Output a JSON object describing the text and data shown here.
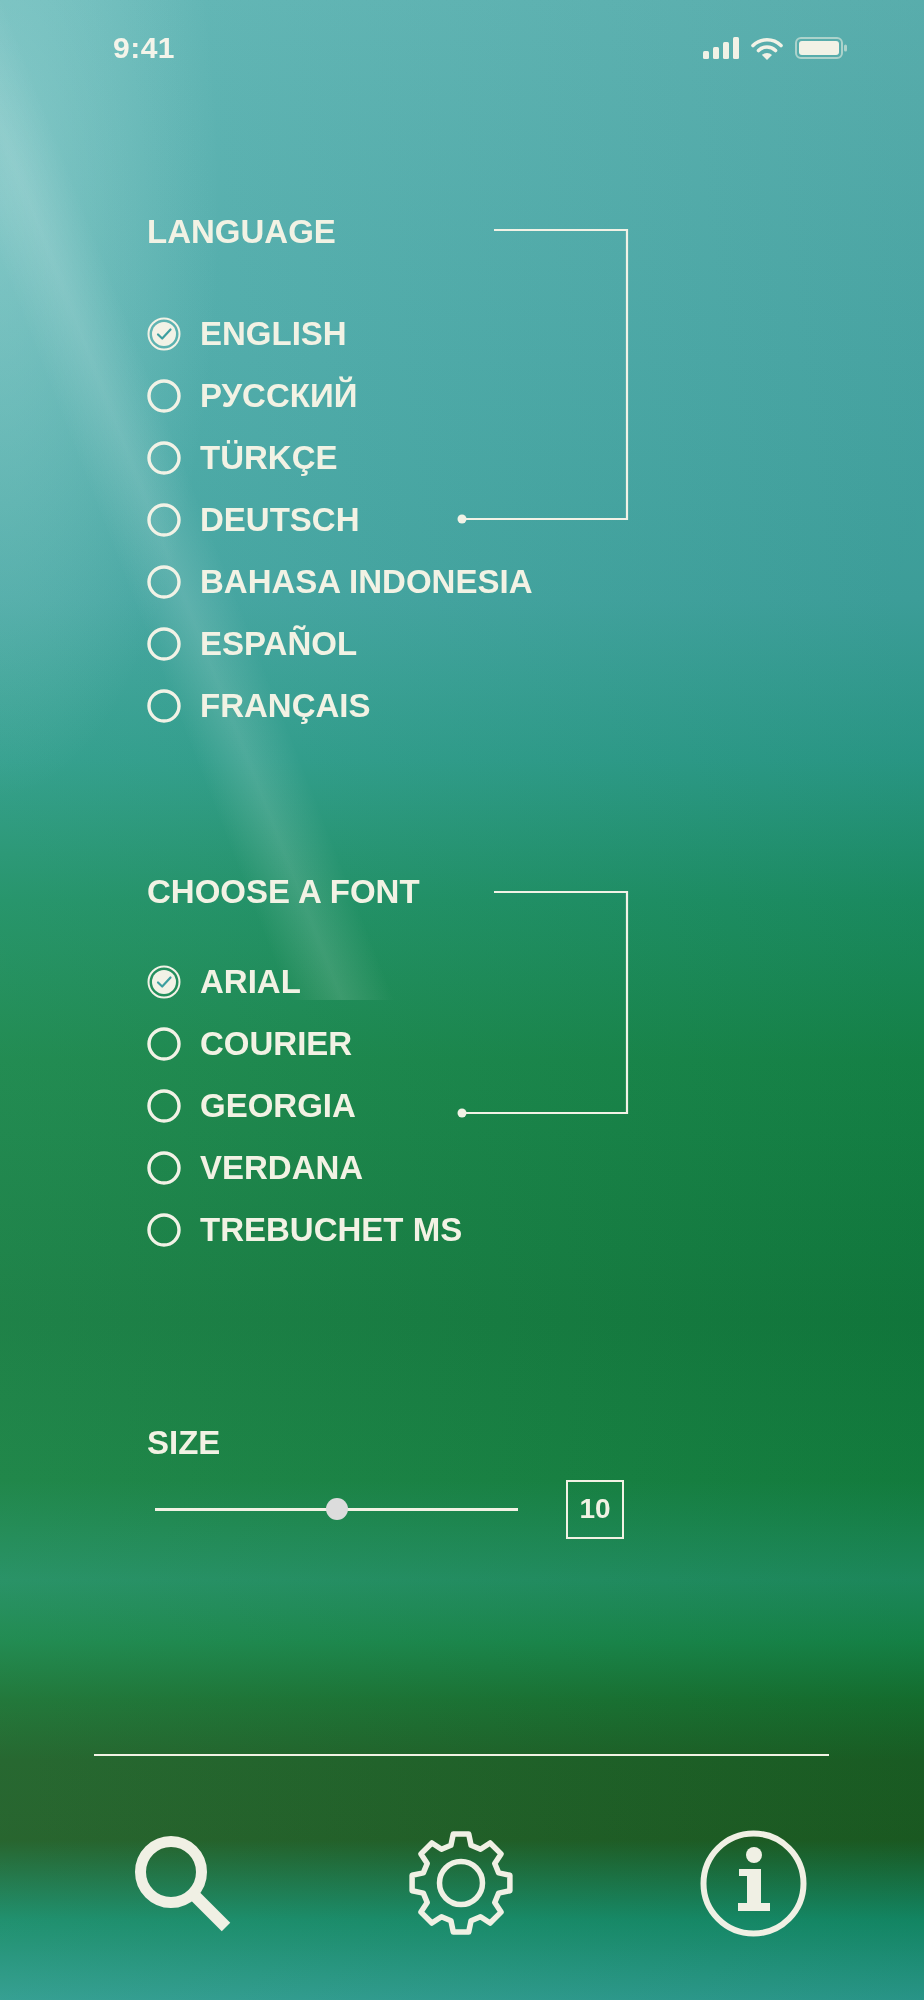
{
  "status_bar": {
    "time": "9:41"
  },
  "language": {
    "title": "LANGUAGE",
    "options": [
      {
        "label": "ENGLISH",
        "selected": true
      },
      {
        "label": "РУССКИЙ",
        "selected": false
      },
      {
        "label": "TÜRKÇE",
        "selected": false
      },
      {
        "label": "DEUTSCH",
        "selected": false
      },
      {
        "label": "BAHASA INDONESIA",
        "selected": false
      },
      {
        "label": "ESPAÑOL",
        "selected": false
      },
      {
        "label": "FRANÇAIS",
        "selected": false
      }
    ]
  },
  "font": {
    "title": "CHOOSE A FONT",
    "options": [
      {
        "label": "ARIAL",
        "selected": true
      },
      {
        "label": "COURIER",
        "selected": false
      },
      {
        "label": "GEORGIA",
        "selected": false
      },
      {
        "label": "VERDANA",
        "selected": false
      },
      {
        "label": "TREBUCHET MS",
        "selected": false
      }
    ]
  },
  "size": {
    "title": "SIZE",
    "level": 0.5,
    "value": "10"
  }
}
